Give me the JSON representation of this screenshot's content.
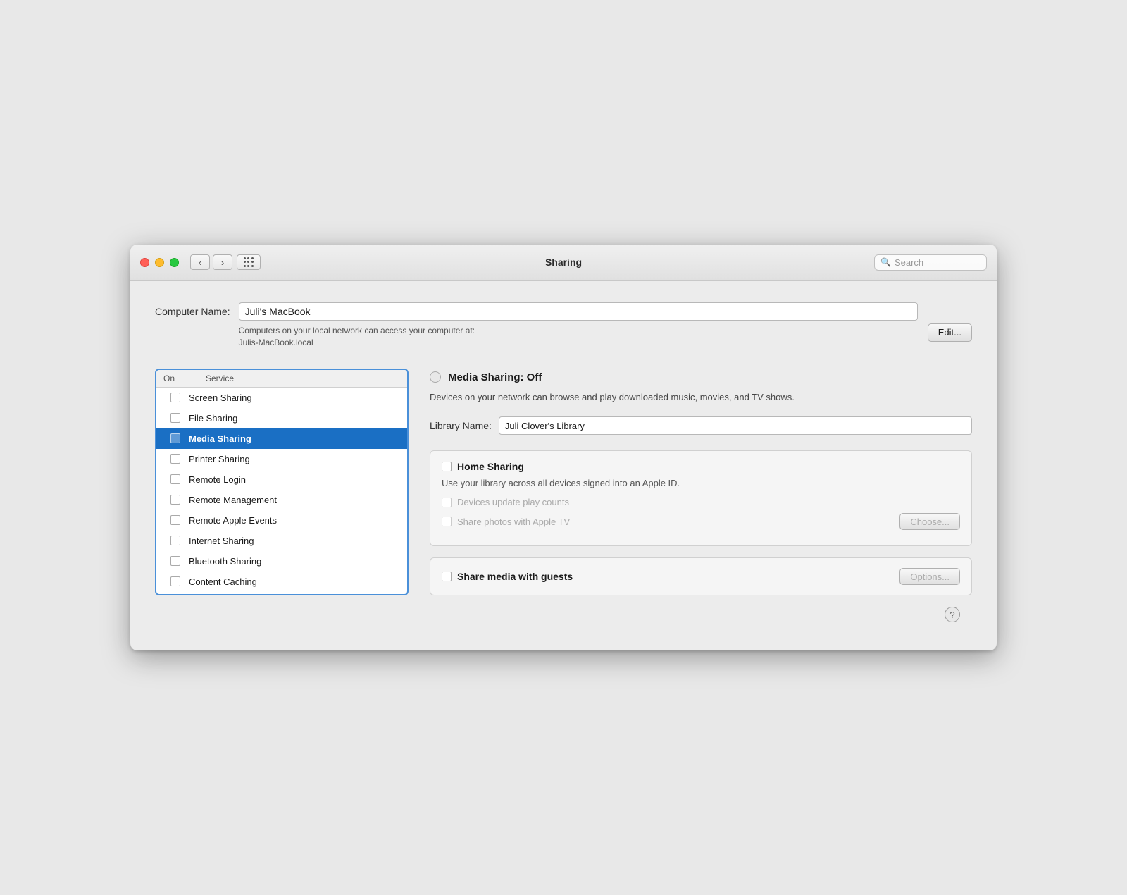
{
  "titlebar": {
    "title": "Sharing",
    "search_placeholder": "Search",
    "back_label": "‹",
    "forward_label": "›"
  },
  "computer_name": {
    "label": "Computer Name:",
    "value": "Juli's MacBook",
    "sublabel_line1": "Computers on your local network can access your computer at:",
    "sublabel_line2": "Julis-MacBook.local",
    "edit_button": "Edit..."
  },
  "services": {
    "col_on": "On",
    "col_service": "Service",
    "items": [
      {
        "name": "Screen Sharing",
        "checked": false,
        "selected": false
      },
      {
        "name": "File Sharing",
        "checked": false,
        "selected": false
      },
      {
        "name": "Media Sharing",
        "checked": false,
        "selected": true
      },
      {
        "name": "Printer Sharing",
        "checked": false,
        "selected": false
      },
      {
        "name": "Remote Login",
        "checked": false,
        "selected": false
      },
      {
        "name": "Remote Management",
        "checked": false,
        "selected": false
      },
      {
        "name": "Remote Apple Events",
        "checked": false,
        "selected": false
      },
      {
        "name": "Internet Sharing",
        "checked": false,
        "selected": false
      },
      {
        "name": "Bluetooth Sharing",
        "checked": false,
        "selected": false
      },
      {
        "name": "Content Caching",
        "checked": false,
        "selected": false
      }
    ]
  },
  "media_sharing": {
    "title": "Media Sharing: Off",
    "description": "Devices on your network can browse and play downloaded music, movies, and TV shows.",
    "library_label": "Library Name:",
    "library_value": "Juli Clover's Library"
  },
  "home_sharing": {
    "checkbox_label": "Home Sharing",
    "description": "Use your library across all devices signed into an Apple ID.",
    "option1": "Devices update play counts",
    "option2": "Share photos with Apple TV",
    "choose_button": "Choose..."
  },
  "share_media": {
    "label": "Share media with guests",
    "options_button": "Options..."
  },
  "help": {
    "label": "?"
  }
}
